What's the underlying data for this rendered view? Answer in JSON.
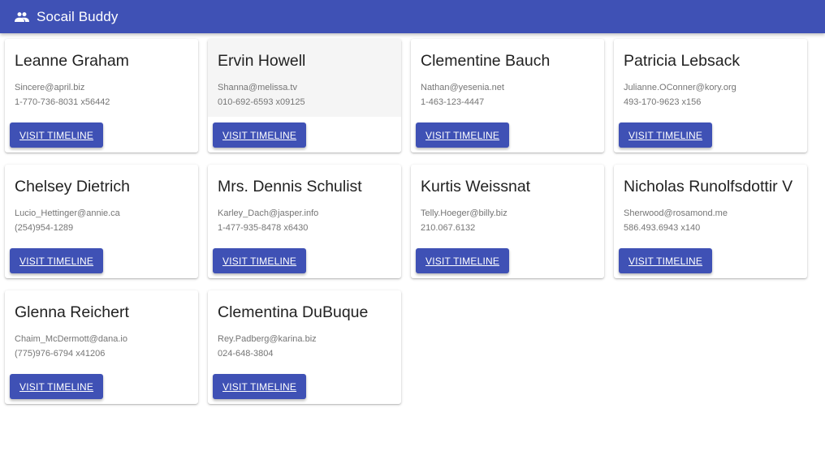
{
  "app": {
    "title": "Socail Buddy",
    "icon": "people-icon",
    "brand_color": "#3f51b5"
  },
  "users": [
    {
      "name": "Leanne Graham",
      "email": "Sincere@april.biz",
      "phone": "1-770-736-8031 x56442",
      "button_label": "VISIT TIMELINE"
    },
    {
      "name": "Ervin Howell",
      "email": "Shanna@melissa.tv",
      "phone": "010-692-6593 x09125",
      "button_label": "VISIT TIMELINE",
      "hovered": true
    },
    {
      "name": "Clementine Bauch",
      "email": "Nathan@yesenia.net",
      "phone": "1-463-123-4447",
      "button_label": "VISIT TIMELINE"
    },
    {
      "name": "Patricia Lebsack",
      "email": "Julianne.OConner@kory.org",
      "phone": "493-170-9623 x156",
      "button_label": "VISIT TIMELINE"
    },
    {
      "name": "Chelsey Dietrich",
      "email": "Lucio_Hettinger@annie.ca",
      "phone": "(254)954-1289",
      "button_label": "VISIT TIMELINE"
    },
    {
      "name": "Mrs. Dennis Schulist",
      "email": "Karley_Dach@jasper.info",
      "phone": "1-477-935-8478 x6430",
      "button_label": "VISIT TIMELINE"
    },
    {
      "name": "Kurtis Weissnat",
      "email": "Telly.Hoeger@billy.biz",
      "phone": "210.067.6132",
      "button_label": "VISIT TIMELINE"
    },
    {
      "name": "Nicholas Runolfsdottir V",
      "email": "Sherwood@rosamond.me",
      "phone": "586.493.6943 x140",
      "button_label": "VISIT TIMELINE"
    },
    {
      "name": "Glenna Reichert",
      "email": "Chaim_McDermott@dana.io",
      "phone": "(775)976-6794 x41206",
      "button_label": "VISIT TIMELINE"
    },
    {
      "name": "Clementina DuBuque",
      "email": "Rey.Padberg@karina.biz",
      "phone": "024-648-3804",
      "button_label": "VISIT TIMELINE"
    }
  ]
}
